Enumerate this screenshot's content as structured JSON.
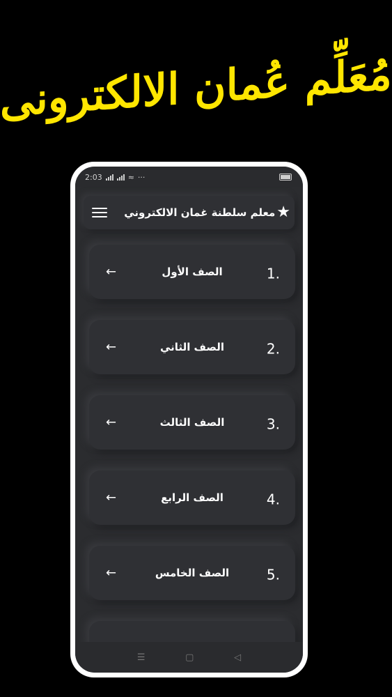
{
  "hero": {
    "text": "مُعَلِّم عُمان الالكترونى"
  },
  "status_bar": {
    "time": "2:03",
    "extra": "···"
  },
  "app_bar": {
    "title": "معلم سلطنة غمان الالكتروني"
  },
  "grades": [
    {
      "number": "1.",
      "label": "الصف الأول"
    },
    {
      "number": "2.",
      "label": "الصف الثاني"
    },
    {
      "number": "3.",
      "label": "الصف الثالث"
    },
    {
      "number": "4.",
      "label": "الصف الرابع"
    },
    {
      "number": "5.",
      "label": "الصف الخامس"
    }
  ],
  "icons": {
    "menu": "hamburger-menu-icon",
    "star": "star-icon",
    "arrow": "arrow-left-icon",
    "nav_menu": "nav-menu-icon",
    "nav_home": "nav-home-icon",
    "nav_back": "nav-back-icon"
  },
  "colors": {
    "accent": "#ffe600",
    "background": "#000000",
    "surface": "#2f3034"
  }
}
